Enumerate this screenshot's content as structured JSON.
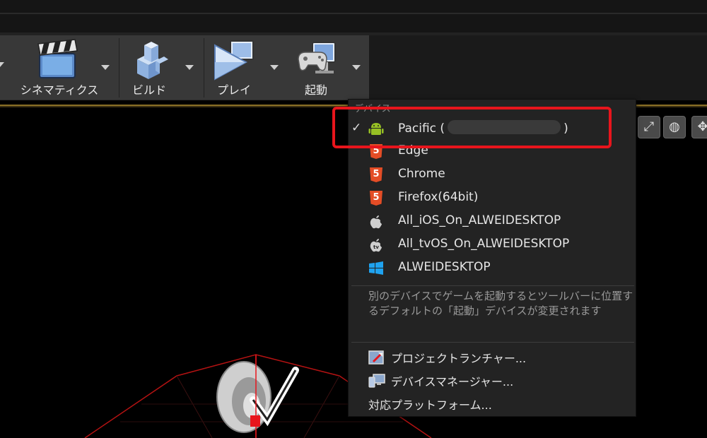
{
  "toolbar": {
    "buttons": [
      {
        "label": "シネマティクス",
        "icon": "clapperboard-icon"
      },
      {
        "label": "ビルド",
        "icon": "build-blocks-icon"
      },
      {
        "label": "プレイ",
        "icon": "play-icon"
      },
      {
        "label": "起動",
        "icon": "gamepad-monitor-icon"
      }
    ]
  },
  "menu": {
    "header": "デバイス",
    "devices": [
      {
        "label_prefix": "Pacific (",
        "label_suffix": ")",
        "icon": "android-icon",
        "checked": true
      },
      {
        "label": "Edge",
        "icon": "html5-icon"
      },
      {
        "label": "Chrome",
        "icon": "html5-icon"
      },
      {
        "label": "Firefox(64bit)",
        "icon": "html5-icon"
      },
      {
        "label": "All_iOS_On_ALWEIDESKTOP",
        "icon": "apple-icon"
      },
      {
        "label": "All_tvOS_On_ALWEIDESKTOP",
        "icon": "apple-tv-icon"
      },
      {
        "label": "ALWEIDESKTOP",
        "icon": "windows-icon"
      }
    ],
    "note": "別のデバイスでゲームを起動するとツールバーに位置するデフォルトの「起動」デバイスが変更されます",
    "actions": [
      {
        "label": "プロジェクトランチャー...",
        "icon": "project-launcher-icon"
      },
      {
        "label": "デバイスマネージャー...",
        "icon": "device-manager-icon"
      },
      {
        "label": "対応プラットフォーム..."
      }
    ],
    "check_glyph": "✓"
  },
  "colors": {
    "highlight": "#e8151c",
    "android": "#97c024",
    "html5": "#e44d26",
    "windows": "#1fa3f0"
  }
}
